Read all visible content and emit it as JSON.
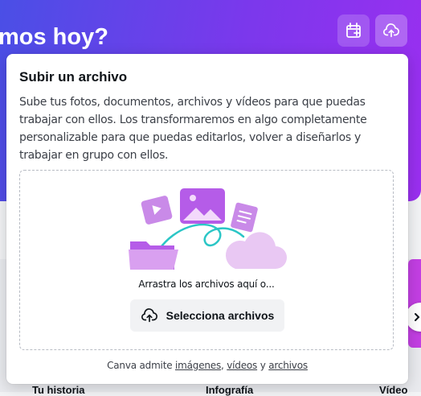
{
  "hero": {
    "title_fragment": "mos hoy?",
    "icons": [
      "calendar-edit-icon",
      "cloud-upload-icon"
    ],
    "gradient": [
      "#4a4fe6",
      "#7b38ec",
      "#9b2ff0"
    ]
  },
  "categories": [
    "Tu historia",
    "Infografía",
    "Vídeo"
  ],
  "upload_panel": {
    "title": "Subir un archivo",
    "description": "Sube tus fotos, documentos, archivos y vídeos para que puedas trabajar con ellos. Los transformaremos en algo completamente personalizable para que puedas editarlos, volver a diseñarlos y trabajar en grupo con ellos.",
    "drop_text": "Arrastra los archivos aquí o...",
    "select_button": "Selecciona archivos",
    "support": {
      "prefix": "Canva admite ",
      "link_images": "imágenes",
      "sep1": ", ",
      "link_videos": "vídeos",
      "sep2": " y ",
      "link_files": "archivos"
    }
  },
  "colors": {
    "illustration_purple": "#b55ce8",
    "accent_teal": "#2bc6c6"
  }
}
